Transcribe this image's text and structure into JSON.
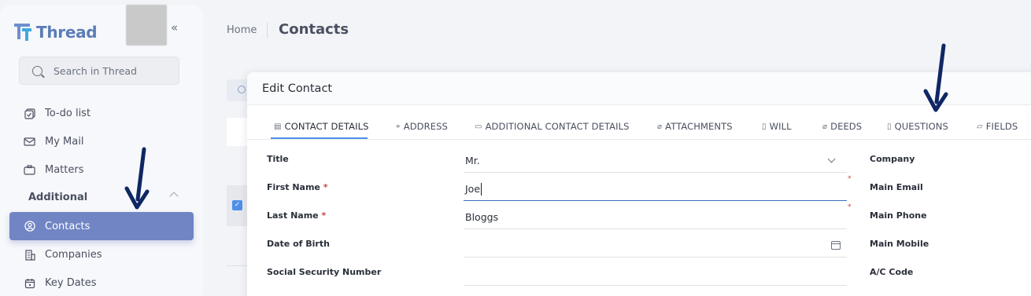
{
  "app": {
    "name": "Thread",
    "collapse_icon": "«"
  },
  "search": {
    "placeholder": "Search in Thread"
  },
  "sidebar": {
    "items": [
      {
        "label": "To-do list",
        "icon": "todo-icon"
      },
      {
        "label": "My Mail",
        "icon": "mail-icon"
      },
      {
        "label": "Matters",
        "icon": "briefcase-icon"
      }
    ],
    "section_label": "Additional",
    "active_item": {
      "label": "Contacts",
      "icon": "contact-icon"
    },
    "items_after": [
      {
        "label": "Companies",
        "icon": "building-icon"
      },
      {
        "label": "Key Dates",
        "icon": "calendar-icon"
      }
    ]
  },
  "breadcrumb": {
    "home": "Home",
    "title": "Contacts"
  },
  "modal": {
    "title": "Edit Contact",
    "tabs": [
      {
        "label": "CONTACT DETAILS",
        "icon": "document-icon",
        "active": true
      },
      {
        "label": "ADDRESS",
        "icon": "location-icon"
      },
      {
        "label": "ADDITIONAL CONTACT DETAILS",
        "icon": "id-card-icon"
      },
      {
        "label": "ATTACHMENTS",
        "icon": "paperclip-icon"
      },
      {
        "label": "WILL",
        "icon": "file-icon"
      },
      {
        "label": "DEEDS",
        "icon": "paperclip-icon"
      },
      {
        "label": "QUESTIONS",
        "icon": "question-file-icon"
      },
      {
        "label": "FIELDS",
        "icon": "comment-icon"
      }
    ],
    "fields": [
      {
        "label": "Title",
        "value": "Mr.",
        "required": false,
        "type": "select"
      },
      {
        "label": "First Name",
        "value": "Joe",
        "required": true,
        "type": "text"
      },
      {
        "label": "Last Name",
        "value": "Bloggs",
        "required": true,
        "type": "text"
      },
      {
        "label": "Date of Birth",
        "value": "",
        "required": false,
        "type": "date"
      },
      {
        "label": "Social Security Number",
        "value": "",
        "required": false,
        "type": "text"
      }
    ],
    "required_marker": "*",
    "right_labels": [
      "Company",
      "Main Email",
      "Main Phone",
      "Main Mobile",
      "A/C Code"
    ]
  },
  "colors": {
    "accent": "#4f8fe8",
    "active_nav": "#7185c4",
    "arrow": "#0f2763"
  }
}
